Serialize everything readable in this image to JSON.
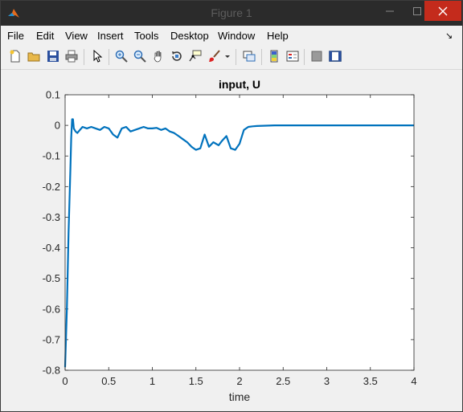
{
  "window": {
    "title": "Figure 1",
    "icon": "matlab-icon"
  },
  "menu": {
    "items": [
      {
        "label": "File"
      },
      {
        "label": "Edit"
      },
      {
        "label": "View"
      },
      {
        "label": "Insert"
      },
      {
        "label": "Tools"
      },
      {
        "label": "Desktop"
      },
      {
        "label": "Window"
      },
      {
        "label": "Help"
      }
    ],
    "overflow_icon": "dock-arrow-icon"
  },
  "toolbar": {
    "buttons": [
      {
        "icon": "new-figure-icon"
      },
      {
        "icon": "open-file-icon"
      },
      {
        "icon": "save-icon"
      },
      {
        "icon": "print-icon"
      },
      {
        "icon": "edit-plot-icon"
      },
      {
        "icon": "zoom-in-icon"
      },
      {
        "icon": "zoom-out-icon"
      },
      {
        "icon": "pan-icon"
      },
      {
        "icon": "rotate-3d-icon"
      },
      {
        "icon": "data-cursor-icon"
      },
      {
        "icon": "brush-icon"
      },
      {
        "icon": "link-plot-icon"
      },
      {
        "icon": "insert-colorbar-icon"
      },
      {
        "icon": "insert-legend-icon"
      },
      {
        "icon": "hide-plot-tools-icon"
      },
      {
        "icon": "show-plot-tools-icon"
      }
    ]
  },
  "colors": {
    "line": "#0072bd",
    "axes_bg": "#ffffff",
    "figure_bg": "#f0f0f0",
    "close_button": "#c42b1c"
  },
  "chart_data": {
    "type": "line",
    "title": "input, U",
    "xlabel": "time",
    "ylabel": "",
    "xlim": [
      0,
      4
    ],
    "ylim": [
      -0.8,
      0.1
    ],
    "xticks": [
      "0",
      "0.5",
      "1",
      "1.5",
      "2",
      "2.5",
      "3",
      "3.5",
      "4"
    ],
    "yticks": [
      "0.1",
      "0",
      "-0.1",
      "-0.2",
      "-0.3",
      "-0.4",
      "-0.5",
      "-0.6",
      "-0.7",
      "-0.8"
    ],
    "grid": false,
    "series": [
      {
        "color": "#0072bd",
        "x": [
          0,
          0.02,
          0.04,
          0.06,
          0.07,
          0.08,
          0.09,
          0.1,
          0.12,
          0.14,
          0.17,
          0.2,
          0.25,
          0.3,
          0.35,
          0.4,
          0.45,
          0.5,
          0.55,
          0.6,
          0.65,
          0.7,
          0.75,
          0.8,
          0.85,
          0.9,
          0.95,
          1.0,
          1.05,
          1.1,
          1.15,
          1.2,
          1.25,
          1.3,
          1.35,
          1.4,
          1.45,
          1.5,
          1.55,
          1.6,
          1.65,
          1.7,
          1.73,
          1.76,
          1.8,
          1.85,
          1.9,
          1.95,
          2.0,
          2.05,
          2.1,
          2.15,
          2.2,
          2.3,
          2.4,
          2.5,
          3.0,
          3.5,
          4.0
        ],
        "y": [
          -0.79,
          -0.6,
          -0.35,
          -0.15,
          -0.04,
          0.02,
          0.02,
          -0.01,
          -0.02,
          -0.025,
          -0.015,
          -0.005,
          -0.01,
          -0.005,
          -0.01,
          -0.015,
          -0.005,
          -0.01,
          -0.03,
          -0.04,
          -0.01,
          -0.005,
          -0.02,
          -0.015,
          -0.01,
          -0.005,
          -0.01,
          -0.01,
          -0.008,
          -0.015,
          -0.01,
          -0.02,
          -0.025,
          -0.035,
          -0.045,
          -0.055,
          -0.07,
          -0.08,
          -0.075,
          -0.03,
          -0.07,
          -0.055,
          -0.06,
          -0.065,
          -0.05,
          -0.035,
          -0.075,
          -0.08,
          -0.06,
          -0.015,
          -0.005,
          -0.003,
          -0.002,
          -0.001,
          0.0,
          0.0,
          0.0,
          0.0,
          0.0
        ]
      }
    ]
  }
}
